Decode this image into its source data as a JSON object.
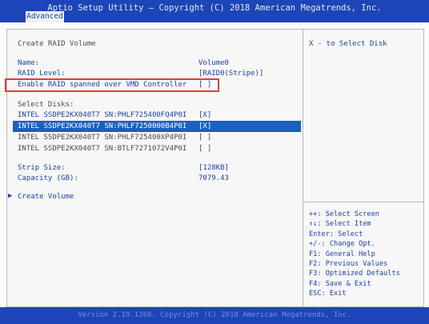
{
  "header": {
    "title": "Aptio Setup Utility – Copyright (C) 2018 American Megatrends, Inc.",
    "tab": "Advanced"
  },
  "main": {
    "section_title": "Create RAID Volume",
    "name_label": "Name:",
    "name_value": "Volume0",
    "raid_level_label": "RAID Level:",
    "raid_level_value": "[RAID0(Stripe)]",
    "vmd_label": "Enable RAID spanned over VMD Controller",
    "vmd_value": "[ ]",
    "select_disks_label": "Select Disks:",
    "disks": [
      {
        "label": "INTEL SSDPE2KX040T7 SN:PHLF725400FQ4P0I",
        "value": "[X]"
      },
      {
        "label": "INTEL SSDPE2KX040T7 SN:PHLF7250000B4P0I",
        "value": "[X]"
      },
      {
        "label": "INTEL SSDPE2KX040T7 SN:PHLF725400XP4P0I",
        "value": "[ ]"
      },
      {
        "label": "INTEL SSDPE2KX040T7 SN:BTLF7271072V4P0I",
        "value": "[ ]"
      }
    ],
    "strip_size_label": "Strip Size:",
    "strip_size_value": "[128KB]",
    "capacity_label": "Capacity (GB):",
    "capacity_value": "7079.43",
    "create_volume_label": "Create Volume"
  },
  "help": {
    "top": "X - to Select Disk",
    "keys": [
      "++: Select Screen",
      "↑↓: Select Item",
      "Enter: Select",
      "+/-: Change Opt.",
      "F1: General Help",
      "F2: Previous Values",
      "F3: Optimized Defaults",
      "F4: Save & Exit",
      "ESC: Exit"
    ]
  },
  "footer": {
    "version": "Version 2.19.1268. Copyright (C) 2018 American Megatrends, Inc."
  },
  "colors": {
    "title_bar": "#1b45b8",
    "text_blue": "#1a3fa8",
    "highlight": "#1d5fbf",
    "annotation_red": "#e33a3a"
  }
}
